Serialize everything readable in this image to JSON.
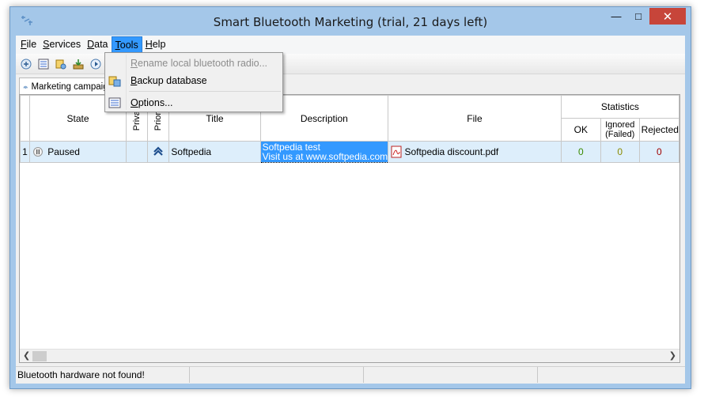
{
  "window": {
    "title": "Smart Bluetooth Marketing (trial, 21 days left)",
    "min_glyph": "—",
    "max_glyph": "□",
    "close_glyph": "✕"
  },
  "menubar": {
    "items": [
      {
        "label": "File",
        "underline": "F",
        "rest": "ile"
      },
      {
        "label": "Services",
        "underline": "S",
        "rest": "ervices"
      },
      {
        "label": "Data",
        "underline": "D",
        "rest": "ata"
      },
      {
        "label": "Tools",
        "underline": "T",
        "rest": "ools"
      },
      {
        "label": "Help",
        "underline": "H",
        "rest": "elp"
      }
    ],
    "active_item": "Tools"
  },
  "tools_menu": {
    "items": [
      {
        "label": "Rename local bluetooth radio...",
        "underline": "R",
        "rest": "ename local bluetooth radio...",
        "enabled": false,
        "icon": "rename-icon"
      },
      {
        "label": "Backup database",
        "underline": "B",
        "rest": "ackup database",
        "enabled": true,
        "icon": "backup-database-icon"
      },
      {
        "label": "Options...",
        "underline": "O",
        "rest": "ptions...",
        "enabled": true,
        "icon": "options-icon"
      }
    ]
  },
  "tabs": [
    {
      "label": "Marketing campaign",
      "icon": "campaign-icon"
    }
  ],
  "grid": {
    "columns": {
      "state": "State",
      "private": "Private",
      "priority": "Priority",
      "title": "Title",
      "description": "Description",
      "file": "File",
      "statistics": "Statistics",
      "ok": "OK",
      "ignored_line1": "Ignored",
      "ignored_line2": "(Failed)",
      "rejected": "Rejected"
    },
    "rows": [
      {
        "num": "1",
        "state": "Paused",
        "title": "Softpedia",
        "description_line1": "Softpedia test",
        "description_line2": "Visit us at www.softpedia.com",
        "file": "Softpedia discount.pdf",
        "ok": "0",
        "ignored": "0",
        "rejected": "0"
      }
    ]
  },
  "statusbar": {
    "message": "Bluetooth hardware not found!"
  },
  "colors": {
    "accent": "#3399ff",
    "ok": "#3a8a00",
    "ignored": "#8a8a00",
    "rejected": "#a00000",
    "close": "#c7453a"
  }
}
